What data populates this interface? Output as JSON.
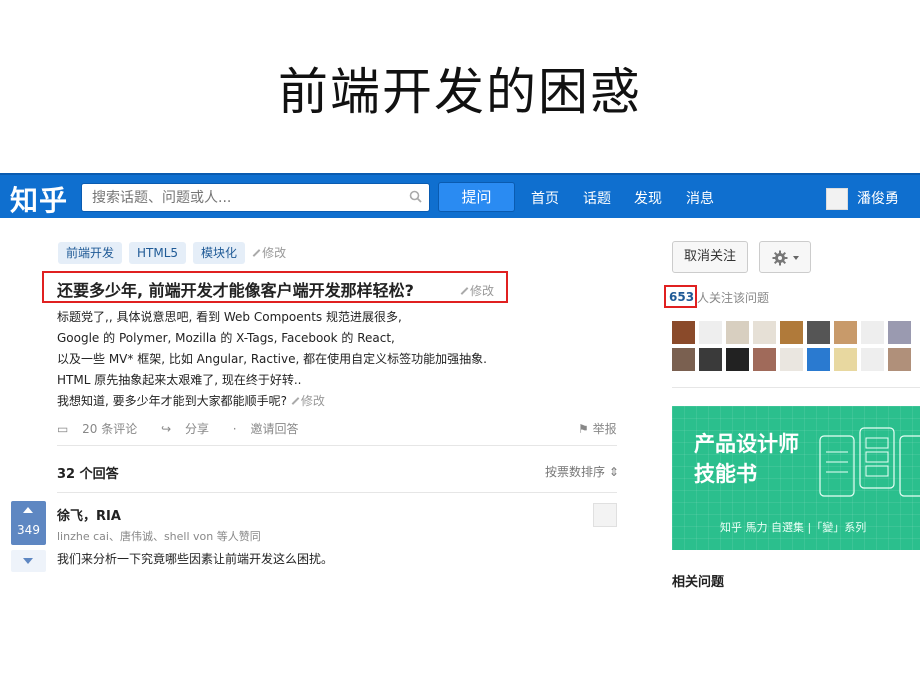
{
  "slide": {
    "title": "前端开发的困惑"
  },
  "topbar": {
    "logo": "知乎",
    "search_placeholder": "搜索话题、问题或人...",
    "ask_label": "提问",
    "nav": [
      "首页",
      "话题",
      "发现",
      "消息"
    ],
    "username": "潘俊勇"
  },
  "question": {
    "tags": [
      "前端开发",
      "HTML5",
      "模块化"
    ],
    "edit_label": "修改",
    "title": "还要多少年, 前端开发才能像客户端开发那样轻松?",
    "body": [
      "标题党了,, 具体说意思吧, 看到 Web Compoents 规范进展很多,",
      "Google 的 Polymer, Mozilla 的 X-Tags, Facebook 的 React,",
      "以及一些 MV* 框架, 比如 Angular, Ractive, 都在使用自定义标签功能加强抽象.",
      "HTML 原先抽象起来太艰难了, 现在终于好转..",
      "我想知道, 要多少年才能到大家都能顺手呢?"
    ],
    "comments": "20 条评论",
    "share": "分享",
    "invite": "邀请回答",
    "report": "举报"
  },
  "answers": {
    "count_label": "32 个回答",
    "sort_label": "按票数排序",
    "first": {
      "votes": "349",
      "author": "徐飞，RIA",
      "voters": "linzhe cai、唐伟诚、shell von 等人赞同",
      "text": "我们来分析一下究竟哪些因素让前端开发这么困扰。"
    }
  },
  "sidebar": {
    "unfollow_label": "取消关注",
    "follow_count": "653",
    "follow_text": "人关注该问题",
    "banner_title1": "产品设计师",
    "banner_title2": "技能书",
    "banner_foot": "知乎 馬力 自選集 |「變」系列",
    "related_title": "相关问题"
  },
  "colors": {
    "topbar": "#0f6fcf",
    "highlight_border": "#e02020",
    "banner": "#2bbf8d"
  }
}
